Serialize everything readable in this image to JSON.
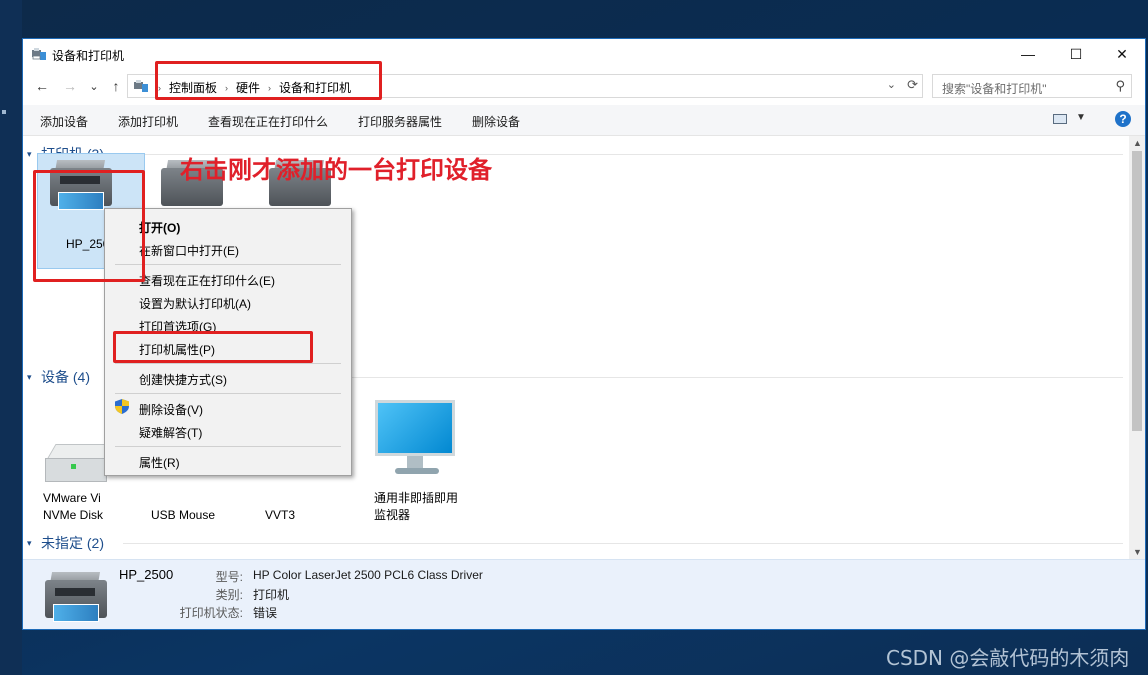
{
  "window": {
    "title": "设备和打印机"
  },
  "window_controls": {
    "minimize": "—",
    "maximize": "☐",
    "close": "✕"
  },
  "nav": {
    "back": "←",
    "forward": "→",
    "recent": "⌄",
    "up": "↑"
  },
  "address": {
    "crumbs": [
      "控制面板",
      "硬件",
      "设备和打印机"
    ],
    "separator": "›"
  },
  "search": {
    "placeholder": "搜索\"设备和打印机\""
  },
  "toolbar": {
    "items": [
      "添加设备",
      "添加打印机",
      "查看现在正在打印什么",
      "打印服务器属性",
      "删除设备"
    ],
    "help": "?"
  },
  "groups": {
    "printers": "打印机 (3)",
    "devices": "设备 (4)",
    "unspecified": "未指定 (2)"
  },
  "printers": [
    {
      "label": "HP_2500"
    }
  ],
  "devices": [
    {
      "line1": "VMware Vi",
      "line2": "NVMe Disk"
    },
    {
      "line1": "",
      "line2": "USB Mouse"
    },
    {
      "line1": "",
      "line2": "VVT3"
    },
    {
      "line1": "通用非即插即用",
      "line2": "监视器"
    }
  ],
  "context_menu": {
    "items": [
      "打开(O)",
      "在新窗口中打开(E)",
      "查看现在正在打印什么(E)",
      "设置为默认打印机(A)",
      "打印首选项(G)",
      "打印机属性(P)",
      "创建快捷方式(S)",
      "删除设备(V)",
      "疑难解答(T)",
      "属性(R)"
    ]
  },
  "annotation": "右击刚才添加的一台打印设备",
  "details": {
    "name": "HP_2500",
    "model_label": "型号:",
    "model_value": "HP Color LaserJet 2500 PCL6 Class Driver",
    "category_label": "类别:",
    "category_value": "打印机",
    "status_label": "打印机状态:",
    "status_value": "错误"
  },
  "watermark": "CSDN @会敲代码的木须肉",
  "colors": {
    "accent": "#1f72c9",
    "highlight_red": "#e02020",
    "selection": "#cce4f7"
  }
}
